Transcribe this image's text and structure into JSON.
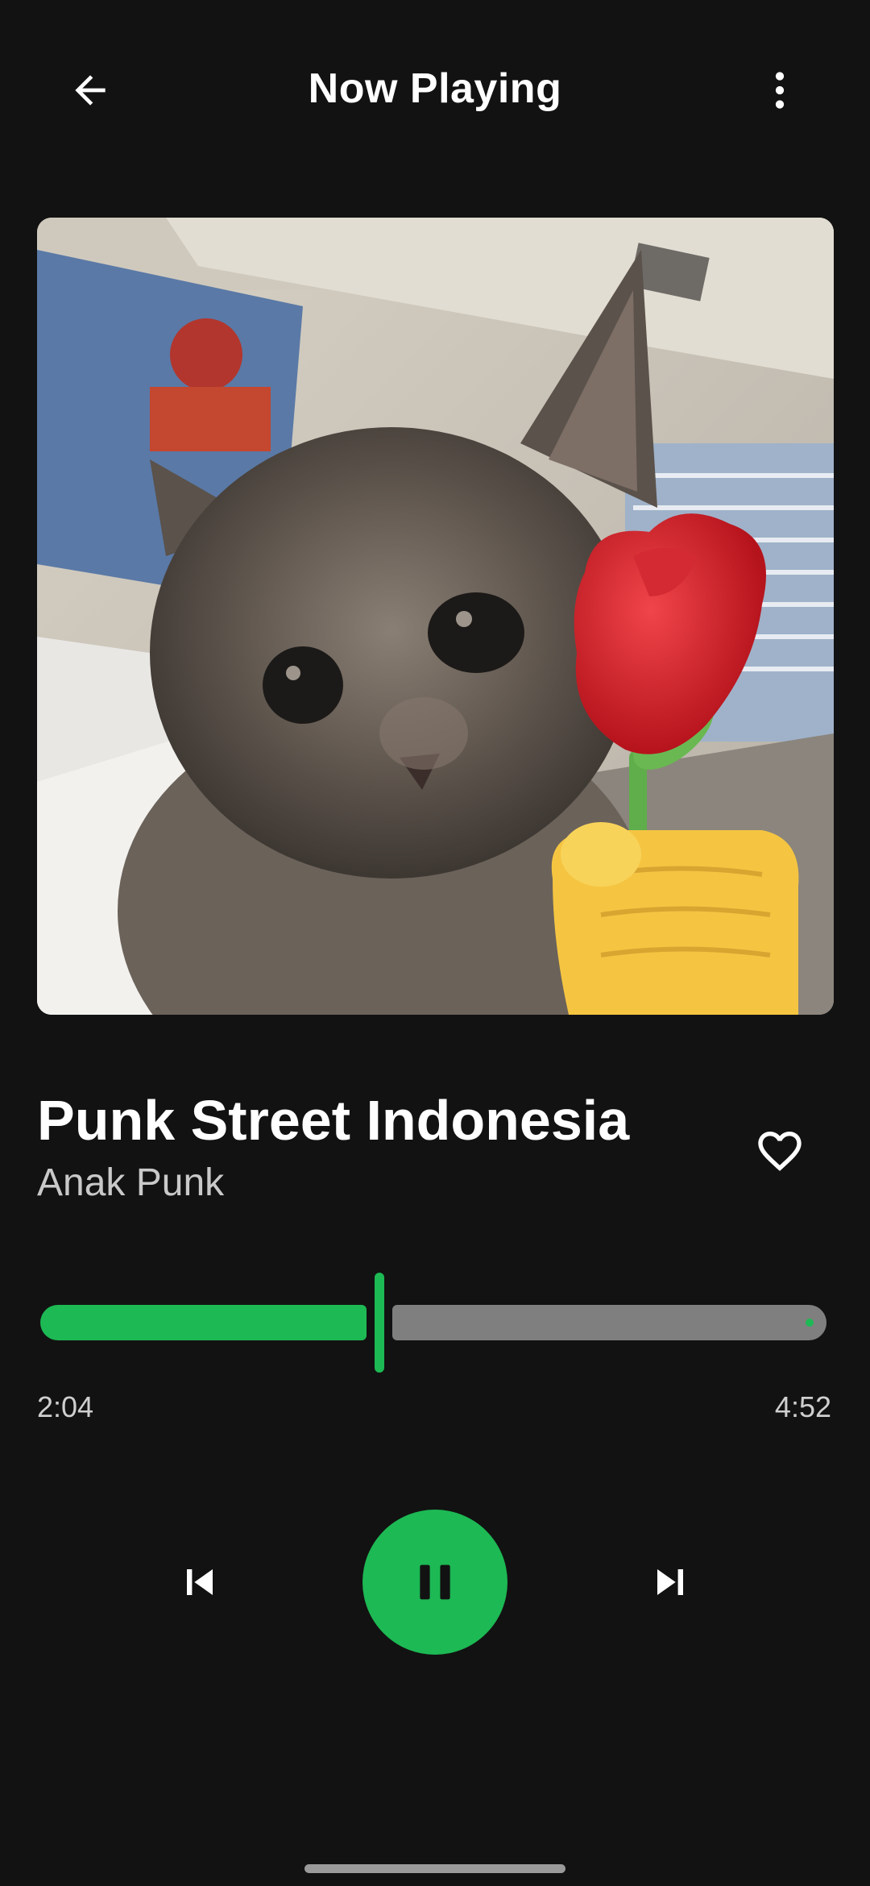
{
  "header": {
    "title": "Now Playing",
    "back_icon": "arrow-back-icon",
    "menu_icon": "more-vertical-icon"
  },
  "artwork": {
    "subject": "kitten holding a red rose emoji",
    "icon": "album-art"
  },
  "track": {
    "title": "Punk Street Indonesia",
    "artist": "Anak Punk",
    "favorite_icon": "heart-outline-icon"
  },
  "playback": {
    "elapsed": "2:04",
    "duration": "4:52",
    "progress_fraction": 0.425,
    "state": "playing"
  },
  "controls": {
    "previous_icon": "skip-previous-icon",
    "pause_icon": "pause-icon",
    "next_icon": "skip-next-icon"
  },
  "colors": {
    "background": "#121212",
    "accent": "#1db954",
    "track_remaining": "#7f7f7f",
    "text_primary": "#ffffff",
    "text_secondary": "#c9c9c9"
  }
}
